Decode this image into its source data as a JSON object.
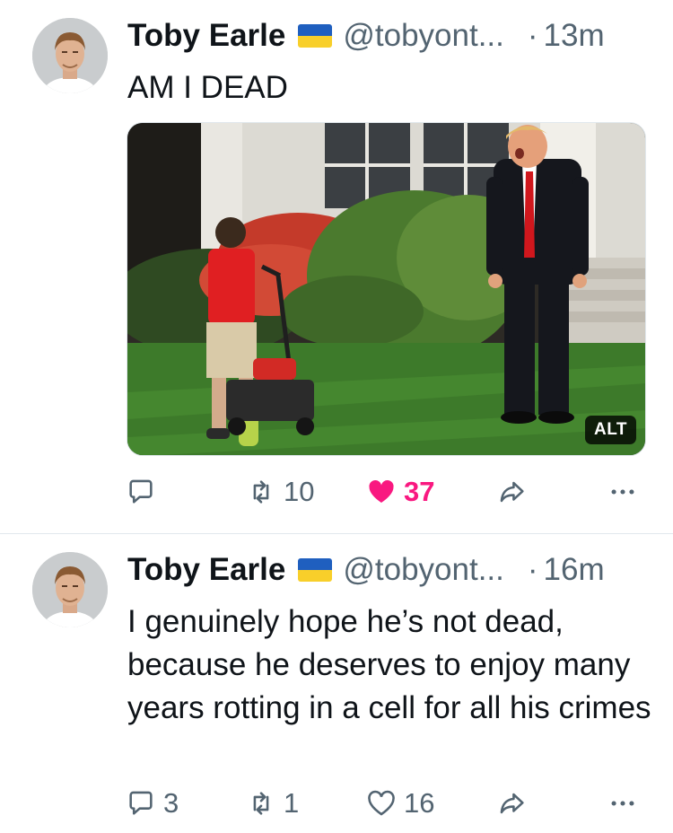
{
  "tweets": [
    {
      "author_name": "Toby Earle",
      "handle": "@tobyont...",
      "separator": "·",
      "time": "13m",
      "text": "AM I DEAD",
      "media": {
        "alt_badge": "ALT"
      },
      "actions": {
        "replies": "",
        "retweets": "10",
        "likes": "37",
        "liked": true
      }
    },
    {
      "author_name": "Toby Earle",
      "handle": "@tobyont...",
      "separator": "·",
      "time": "16m",
      "text": "I genuinely hope he’s not dead, because he deserves to enjoy many years rotting in a cell for all his crimes",
      "actions": {
        "replies": "3",
        "retweets": "1",
        "likes": "16",
        "liked": false
      }
    }
  ],
  "colors": {
    "like_active": "#f91880",
    "icon_gray": "#536471",
    "flag_blue": "#1f5fbf",
    "flag_yellow": "#f8cf2a",
    "divider": "#e1e8ed"
  },
  "icons": [
    "reply-icon",
    "retweet-icon",
    "heart-icon",
    "share-icon",
    "more-icon",
    "ukraine-flag-icon"
  ]
}
